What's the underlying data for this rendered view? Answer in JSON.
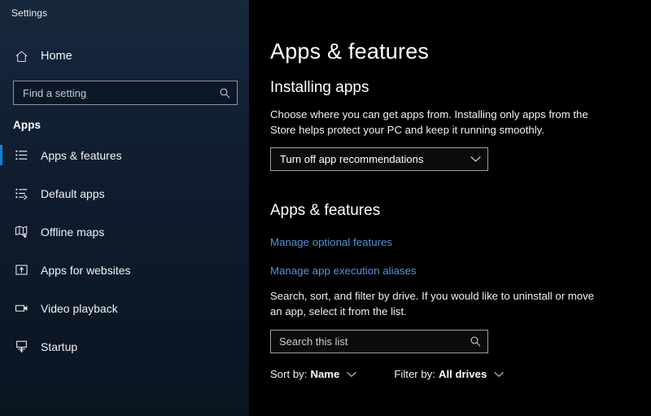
{
  "window": {
    "title": "Settings"
  },
  "sidebar": {
    "home": {
      "label": "Home",
      "icon": "home-icon"
    },
    "search": {
      "placeholder": "Find a setting",
      "value": "",
      "icon": "search-icon"
    },
    "group_title": "Apps",
    "items": [
      {
        "label": "Apps & features",
        "icon": "list-icon",
        "selected": true
      },
      {
        "label": "Default apps",
        "icon": "list-arrow-icon",
        "selected": false
      },
      {
        "label": "Offline maps",
        "icon": "map-download-icon",
        "selected": false
      },
      {
        "label": "Apps for websites",
        "icon": "window-arrow-icon",
        "selected": false
      },
      {
        "label": "Video playback",
        "icon": "video-camera-icon",
        "selected": false
      },
      {
        "label": "Startup",
        "icon": "monitor-arrow-icon",
        "selected": false
      }
    ],
    "accent_color": "#0a84d8"
  },
  "main": {
    "page_title": "Apps & features",
    "installing": {
      "heading": "Installing apps",
      "description": "Choose where you can get apps from. Installing only apps from the Store helps protect your PC and keep it running smoothly.",
      "dropdown": {
        "value": "Turn off app recommendations",
        "icon": "chevron-down-icon"
      }
    },
    "features": {
      "heading": "Apps & features",
      "links": [
        {
          "label": "Manage optional features"
        },
        {
          "label": "Manage app execution aliases"
        }
      ],
      "description": "Search, sort, and filter by drive. If you would like to uninstall or move an app, select it from the list.",
      "search": {
        "placeholder": "Search this list",
        "value": "",
        "icon": "search-icon"
      },
      "sort": {
        "prefix": "Sort by:",
        "value": "Name",
        "icon": "chevron-down-icon"
      },
      "filter": {
        "prefix": "Filter by:",
        "value": "All drives",
        "icon": "chevron-down-icon"
      }
    },
    "link_color": "#4f93dd"
  }
}
